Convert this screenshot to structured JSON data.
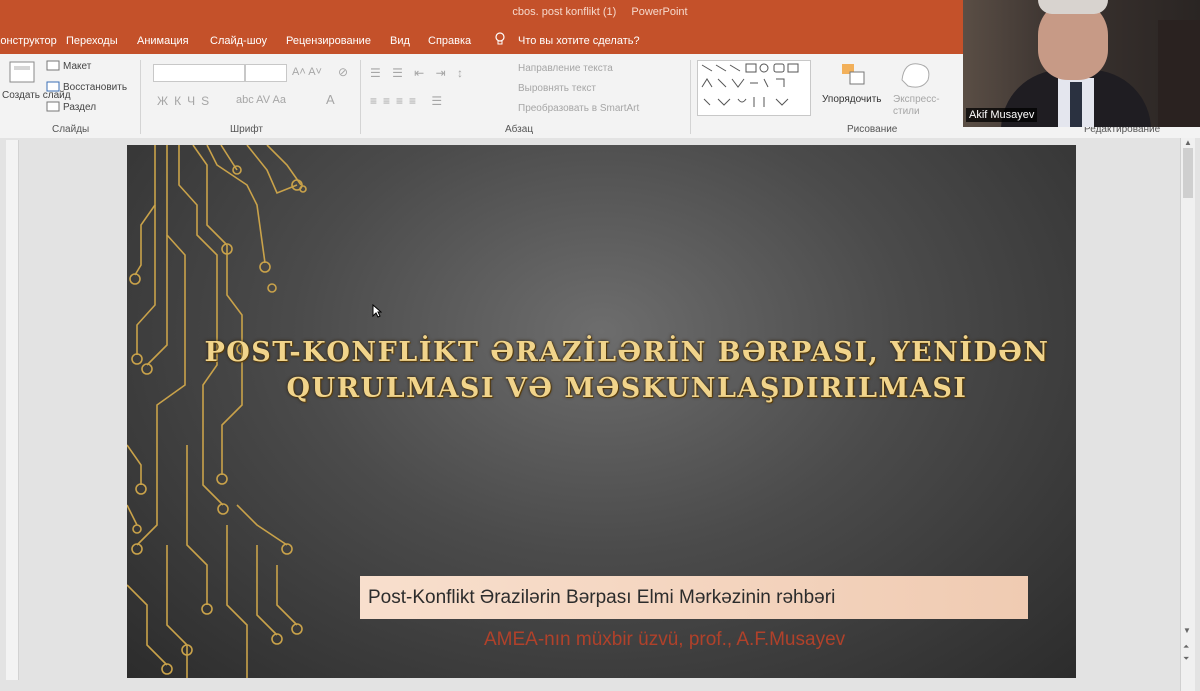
{
  "window": {
    "title_parts": [
      "cbos. post konflikt (1)",
      "PowerPoint"
    ]
  },
  "tabs": [
    {
      "label": "Конструктор"
    },
    {
      "label": "Переходы"
    },
    {
      "label": "Анимация"
    },
    {
      "label": "Слайд-шоу"
    },
    {
      "label": "Рецензирование"
    },
    {
      "label": "Вид"
    },
    {
      "label": "Справка"
    },
    {
      "label": "Что вы хотите сделать?"
    }
  ],
  "ribbon": {
    "slides_group": {
      "new_slide_label": "Создать слайд",
      "layout_label": "Макет",
      "reset_label": "Восстановить",
      "section_label": "Раздел",
      "group_label": "Слайды"
    },
    "font_group": {
      "group_label": "Шрифт"
    },
    "paragraph_group": {
      "text_direction_label": "Направление текста",
      "align_text_label": "Выровнять текст",
      "smartart_label": "Преобразовать в SmartArt",
      "group_label": "Абзац"
    },
    "drawing_group": {
      "arrange_label": "Упорядочить",
      "quick_styles_label": "Экспресс-стили",
      "group_label": "Рисование"
    },
    "editing_group": {
      "group_label": "Редактирование"
    }
  },
  "video": {
    "participant_name": "Akif Musayev"
  },
  "slide": {
    "title_line1": "POST-KONFLİKT ƏRAZİLƏRİN BƏRPASI, YENİDƏN",
    "title_line2": "QURULMASI VƏ MƏSKUNLAŞDIRILMASI",
    "subtitle": "Post-Konflikt Ərazilərin Bərpası Elmi Mərkəzinin rəhbəri",
    "author": "AMEA-nın müxbir üzvü, prof., A.F.Musayev"
  },
  "colors": {
    "accent": "#c4512a",
    "slide_title": "#f1d48b",
    "author_text": "#b0412a",
    "circuit": "#c9a24a"
  },
  "icons": [
    "lightbulb-icon",
    "new-slide-icon",
    "layout-icon",
    "reset-icon",
    "section-icon",
    "arrange-icon",
    "quick-styles-icon",
    "cursor-icon"
  ]
}
